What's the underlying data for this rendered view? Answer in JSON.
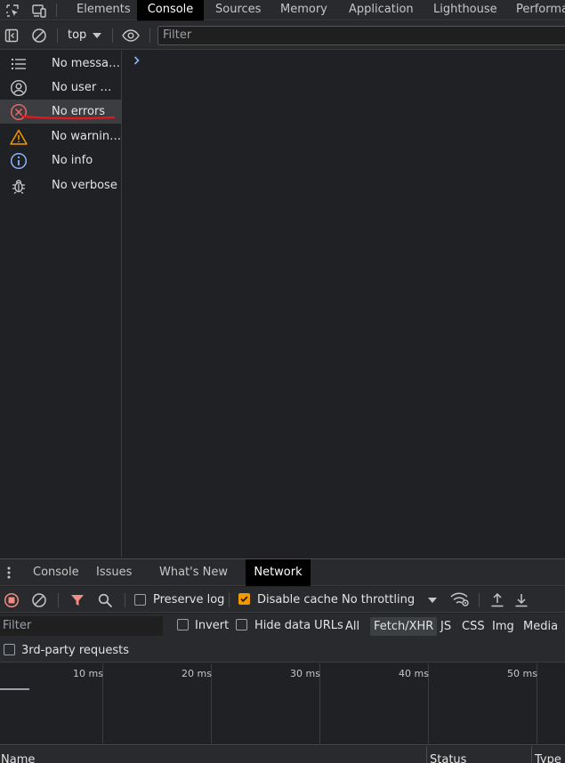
{
  "tabs": [
    {
      "label": "Elements"
    },
    {
      "label": "Console"
    },
    {
      "label": "Sources"
    },
    {
      "label": "Memory"
    },
    {
      "label": "Application"
    },
    {
      "label": "Lighthouse"
    },
    {
      "label": "Performa"
    }
  ],
  "console_toolbar": {
    "context": "top",
    "filter_placeholder": "Filter"
  },
  "sidebar": {
    "items": [
      {
        "label": "No messag...",
        "icon": "list-icon"
      },
      {
        "label": "No user m...",
        "icon": "user-icon"
      },
      {
        "label": "No errors",
        "icon": "error-icon"
      },
      {
        "label": "No warnings",
        "icon": "warning-icon"
      },
      {
        "label": "No info",
        "icon": "info-icon"
      },
      {
        "label": "No verbose",
        "icon": "bug-icon"
      }
    ]
  },
  "drawer": {
    "tabs": [
      {
        "label": "Console"
      },
      {
        "label": "Issues"
      },
      {
        "label": "What's New"
      },
      {
        "label": "Network"
      }
    ]
  },
  "network": {
    "preserve_log": "Preserve log",
    "disable_cache": "Disable cache",
    "throttling": "No throttling",
    "filter_placeholder": "Filter",
    "invert": "Invert",
    "hide_data_urls": "Hide data URLs",
    "types": [
      "All",
      "Fetch/XHR",
      "JS",
      "CSS",
      "Img",
      "Media"
    ],
    "third_party": "3rd-party requests",
    "timeline_labels": [
      "10 ms",
      "20 ms",
      "30 ms",
      "40 ms",
      "50 ms"
    ],
    "columns": [
      "Name",
      "Status",
      "Type"
    ]
  },
  "colors": {
    "accent_orange": "#f29900",
    "record_red": "#f28b82",
    "error_red": "#e46962",
    "warning_orange": "#f29900",
    "info_blue": "#8ab4f8"
  }
}
